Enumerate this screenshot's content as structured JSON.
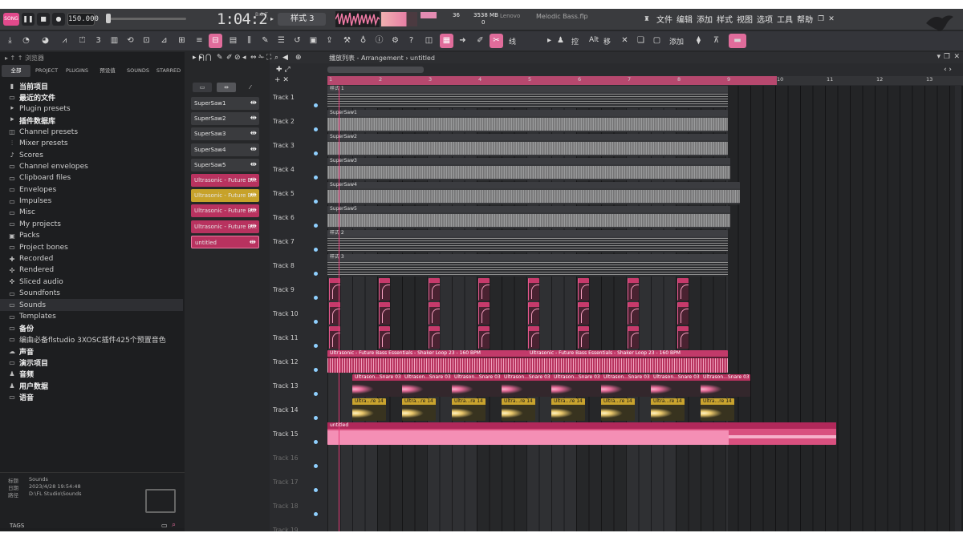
{
  "app": {
    "tempo": "150.000",
    "timecode": "1:04:20",
    "timecode_unit": "B:S:T",
    "pattern": "样式 3",
    "cpu_value": "36",
    "memory": "3538 MB",
    "polyphony": "0",
    "audio_device": "Lenovo",
    "project_title": "Melodic Bass.flp",
    "menu": [
      "文件",
      "编辑",
      "添加",
      "样式",
      "视图",
      "选项",
      "工具",
      "帮助"
    ],
    "add_label": "添加",
    "search_hint": "线",
    "ctrl_hint_1": "控",
    "ctrl_hint_2": "Alt",
    "ctrl_hint_3": "移"
  },
  "colors": {
    "accent": "#e06c9b",
    "clip_pink": "#b8325f",
    "clip_yellow": "#c9a32e",
    "background": "#262729"
  },
  "browser": {
    "title": "浏览器",
    "tabs": [
      "全部",
      "PROJECT",
      "PLUGINS",
      "预设值",
      "SOUNDS",
      "STARRED"
    ],
    "items": [
      {
        "label": "当前项目",
        "icon": "doc-icon",
        "bold": true
      },
      {
        "label": "最近的文件",
        "icon": "folder-icon",
        "bold": true
      },
      {
        "label": "Plugin presets",
        "icon": "plug-icon",
        "bold": false
      },
      {
        "label": "插件数据库",
        "icon": "plug-icon",
        "bold": true
      },
      {
        "label": "Channel presets",
        "icon": "channel-icon",
        "bold": false
      },
      {
        "label": "Mixer presets",
        "icon": "mixer-icon",
        "bold": false
      },
      {
        "label": "Scores",
        "icon": "note-icon",
        "bold": false
      },
      {
        "label": "Channel envelopes",
        "icon": "folder-icon",
        "bold": false
      },
      {
        "label": "Clipboard files",
        "icon": "folder-icon",
        "bold": false
      },
      {
        "label": "Envelopes",
        "icon": "folder-icon",
        "bold": false
      },
      {
        "label": "Impulses",
        "icon": "folder-icon",
        "bold": false
      },
      {
        "label": "Misc",
        "icon": "folder-icon",
        "bold": false
      },
      {
        "label": "My projects",
        "icon": "folder-icon",
        "bold": false
      },
      {
        "label": "Packs",
        "icon": "pack-icon",
        "bold": false
      },
      {
        "label": "Project bones",
        "icon": "folder-icon",
        "bold": false
      },
      {
        "label": "Recorded",
        "icon": "record-icon",
        "bold": false
      },
      {
        "label": "Rendered",
        "icon": "render-icon",
        "bold": false
      },
      {
        "label": "Sliced audio",
        "icon": "slice-icon",
        "bold": false
      },
      {
        "label": "Soundfonts",
        "icon": "folder-icon",
        "bold": false
      },
      {
        "label": "Sounds",
        "icon": "folder-icon",
        "bold": false,
        "selected": true
      },
      {
        "label": "Templates",
        "icon": "folder-icon",
        "bold": false
      },
      {
        "label": "备份",
        "icon": "folder-icon",
        "bold": true
      },
      {
        "label": "编曲必备flstudio 3XOSC插件425个预置音色",
        "icon": "folder-icon",
        "bold": false
      },
      {
        "label": "声音",
        "icon": "cloud-icon",
        "bold": true
      },
      {
        "label": "演示项目",
        "icon": "folder-icon",
        "bold": true
      },
      {
        "label": "音频",
        "icon": "user-icon",
        "bold": true
      },
      {
        "label": "用户数据",
        "icon": "user-icon",
        "bold": true
      },
      {
        "label": "语音",
        "icon": "folder-icon",
        "bold": true
      }
    ],
    "info": {
      "name_label": "标题",
      "name_value": "Sounds",
      "date_label": "日期",
      "date_value": "2023/4/28 19:54:48",
      "path_label": "路径",
      "path_value": "D:\\FL Studio\\Sounds"
    },
    "tags_label": "TAGS"
  },
  "channels": [
    {
      "label": "SuperSaw1",
      "style": "gray"
    },
    {
      "label": "SuperSaw2",
      "style": "gray"
    },
    {
      "label": "SuperSaw3",
      "style": "gray"
    },
    {
      "label": "SuperSaw4",
      "style": "gray"
    },
    {
      "label": "SuperSaw5",
      "style": "gray"
    },
    {
      "label": "Ultrasonic - Future B...",
      "style": "pink"
    },
    {
      "label": "Ultrasonic - Future B...",
      "style": "yellow"
    },
    {
      "label": "Ultrasonic - Future B...",
      "style": "pink"
    },
    {
      "label": "Ultrasonic - Future B...",
      "style": "pink"
    },
    {
      "label": "untitled",
      "style": "pink-sel"
    }
  ],
  "playlist": {
    "title": "播放列表 - Arrangement › untitled",
    "bars": [
      "1",
      "2",
      "3",
      "4",
      "5",
      "6",
      "7",
      "8",
      "9",
      "10",
      "11",
      "12",
      "13"
    ],
    "tracks": [
      "Track 1",
      "Track 2",
      "Track 3",
      "Track 4",
      "Track 5",
      "Track 6",
      "Track 7",
      "Track 8",
      "Track 9",
      "Track 10",
      "Track 11",
      "Track 12",
      "Track 13",
      "Track 14",
      "Track 15",
      "Track 16",
      "Track 17",
      "Track 18",
      "Track 19"
    ],
    "clips": {
      "t1": "样式 1",
      "t2": "SuperSaw1",
      "t3": "SuperSaw2",
      "t4": "SuperSaw3",
      "t5": "SuperSaw4",
      "t6": "SuperSaw5",
      "t7": "样式 2",
      "t8": "样式 3",
      "t12": "Ultrasonic - Future Bass Essentials - Shaker Loop 23 - 160 BPM",
      "t13": "Ultrason...Snare 03",
      "t14": "Ultra...re 14",
      "t15": "untitled"
    }
  }
}
